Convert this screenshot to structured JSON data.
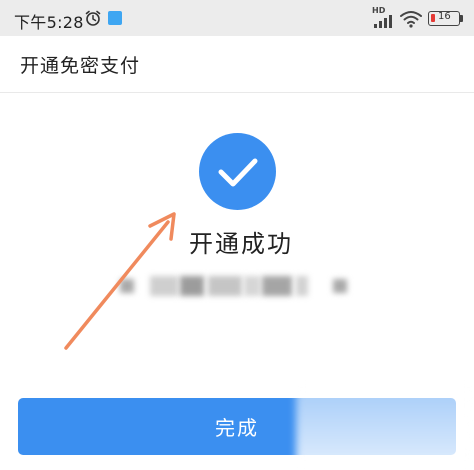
{
  "status_bar": {
    "time": "下午5:28",
    "network_label": "HD",
    "battery_level": "16",
    "battery_fill_color": "#e53935"
  },
  "icons": {
    "alarm": "alarm-clock-icon",
    "app_notification": "app-notification-icon",
    "signal": "signal-icon",
    "wifi": "wifi-icon",
    "battery": "battery-icon",
    "success": "checkmark-icon",
    "annotation": "arrow-icon"
  },
  "header": {
    "title": "开通免密支付"
  },
  "result": {
    "status_text": "开通成功"
  },
  "actions": {
    "done_label": "完成"
  },
  "colors": {
    "accent": "#3b8ff0",
    "annotation_arrow": "#f08a5d",
    "status_bar_bg": "#ececec"
  }
}
